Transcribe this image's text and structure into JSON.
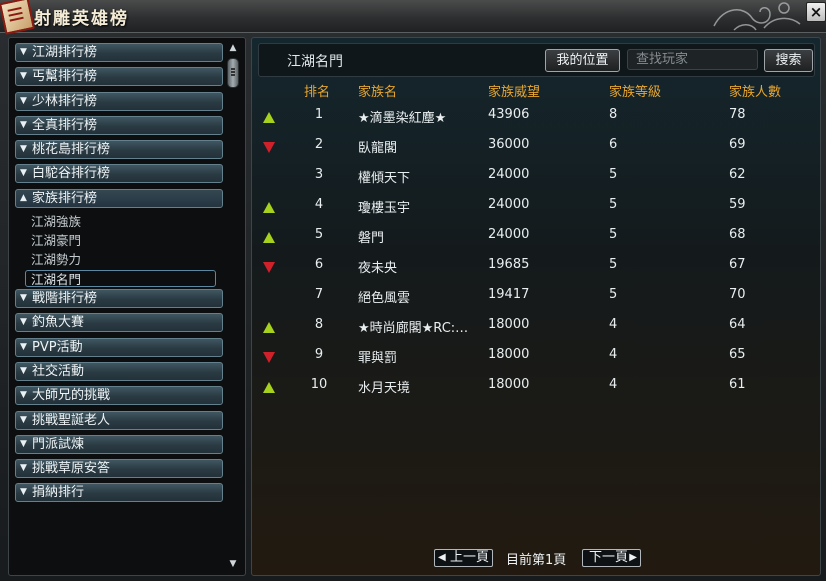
{
  "window": {
    "title": "射雕英雄榜",
    "close_label": "×"
  },
  "sidebar": {
    "categories_top": [
      "江湖排行榜",
      "丐幫排行榜",
      "少林排行榜",
      "全真排行榜",
      "桃花島排行榜",
      "白駝谷排行榜"
    ],
    "open_category": "家族排行榜",
    "sub_items": [
      "江湖強族",
      "江湖豪門",
      "江湖勢力",
      "江湖名門"
    ],
    "selected_sub": "江湖名門",
    "categories_bottom": [
      "戰階排行榜",
      "釣魚大賽",
      "PVP活動",
      "社交活動",
      "大師兄的挑戰",
      "挑戰聖誕老人",
      "門派試煉",
      "挑戰草原安答",
      "捐納排行"
    ]
  },
  "header": {
    "title": "江湖名門",
    "my_position_label": "我的位置",
    "search_placeholder": "查找玩家",
    "search_button_label": "搜索"
  },
  "table": {
    "columns": [
      "排名",
      "家族名",
      "家族威望",
      "家族等級",
      "家族人數"
    ],
    "rows": [
      {
        "trend": "up",
        "rank": "1",
        "name": "★滴墨染紅塵★",
        "prestige": "43906",
        "level": "8",
        "members": "78"
      },
      {
        "trend": "down",
        "rank": "2",
        "name": "臥龍閣",
        "prestige": "36000",
        "level": "6",
        "members": "69"
      },
      {
        "trend": "none",
        "rank": "3",
        "name": "權傾天下",
        "prestige": "24000",
        "level": "5",
        "members": "62"
      },
      {
        "trend": "up",
        "rank": "4",
        "name": "瓊樓玉宇",
        "prestige": "24000",
        "level": "5",
        "members": "59"
      },
      {
        "trend": "up",
        "rank": "5",
        "name": "磐門",
        "prestige": "24000",
        "level": "5",
        "members": "68"
      },
      {
        "trend": "down",
        "rank": "6",
        "name": "夜未央",
        "prestige": "19685",
        "level": "5",
        "members": "67"
      },
      {
        "trend": "none",
        "rank": "7",
        "name": "絕色風雲",
        "prestige": "19417",
        "level": "5",
        "members": "70"
      },
      {
        "trend": "up",
        "rank": "8",
        "name": "★時尚廊閣★RC:…",
        "prestige": "18000",
        "level": "4",
        "members": "64"
      },
      {
        "trend": "down",
        "rank": "9",
        "name": "罪與罰",
        "prestige": "18000",
        "level": "4",
        "members": "65"
      },
      {
        "trend": "up",
        "rank": "10",
        "name": "水月天境",
        "prestige": "18000",
        "level": "4",
        "members": "61"
      }
    ]
  },
  "pager": {
    "prev_label": "上一頁",
    "info": "目前第1頁",
    "next_label": "下一頁"
  },
  "colors": {
    "header_text": "#e8a62f",
    "trend_up": "#a6d21d",
    "trend_down": "#d0212a"
  }
}
